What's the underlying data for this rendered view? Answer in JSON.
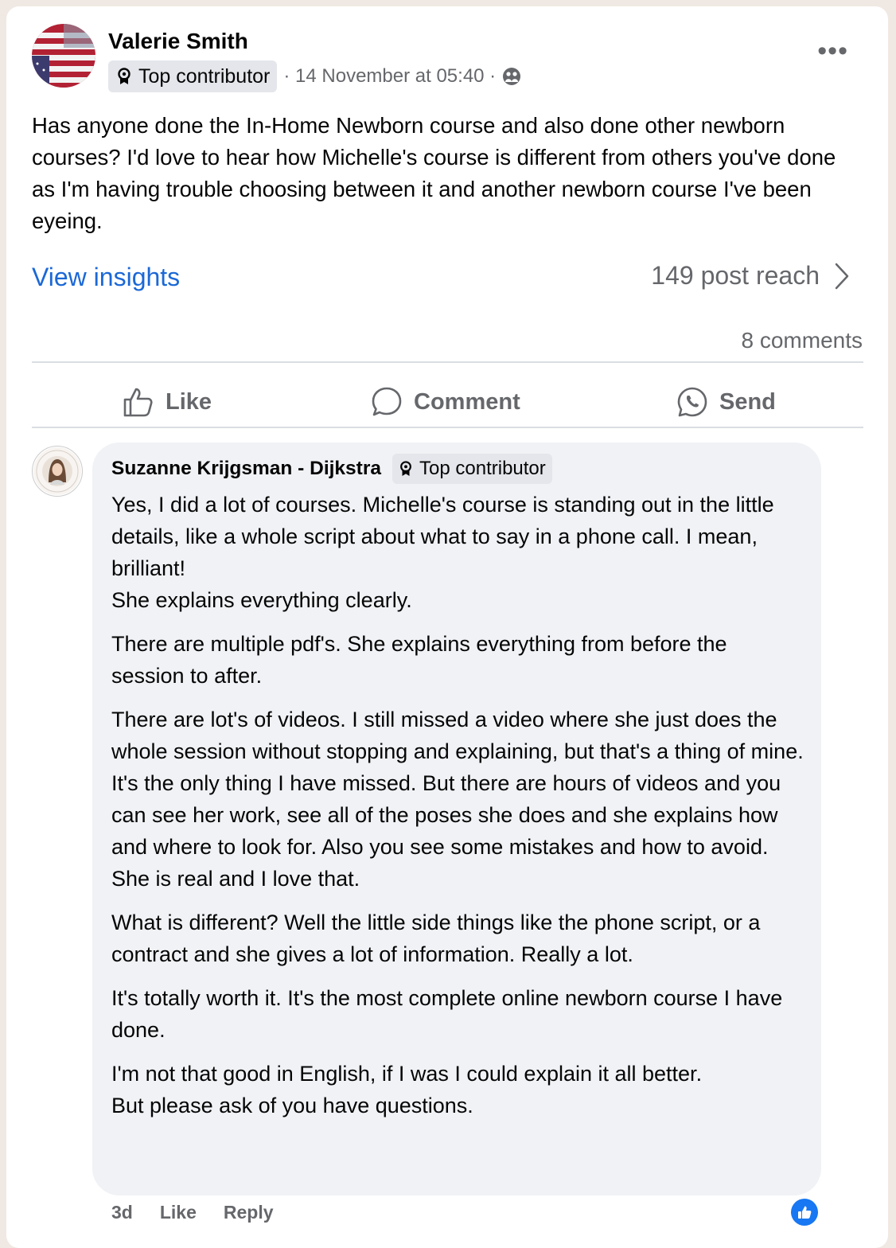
{
  "post": {
    "author": "Valerie Smith",
    "badge": "Top contributor",
    "timestamp": "· 14 November at 05:40 ·",
    "privacy_icon": "group-icon",
    "more_label": "•••",
    "text": "Has anyone done the In-Home Newborn course and also done other newborn courses? I'd love to hear how Michelle's course is different from others you've done as I'm having trouble choosing between it and another newborn course I've been eyeing.",
    "view_insights": "View insights",
    "reach": "149 post reach",
    "comments_count": "8 comments"
  },
  "actions": {
    "like": "Like",
    "comment": "Comment",
    "send": "Send"
  },
  "comment": {
    "author": "Suzanne Krijgsman - Dijkstra",
    "badge": "Top contributor",
    "paragraphs": [
      [
        "Yes, I did a lot of courses. Michelle's course is standing out in the little details, like a whole script about what to say in a phone call. I mean, brilliant!",
        "She explains everything clearly."
      ],
      [
        "There are multiple pdf's. She explains everything from before the session to after."
      ],
      [
        "There are lot's of videos. I still missed a video where she just does the whole session without stopping and explaining, but that's a thing of mine. It's the only thing I have missed. But there are hours of videos and you can see her work, see all of the poses she does and she explains how and where to look for. Also you see some mistakes and how to avoid. She is real and I love that."
      ],
      [
        "What is different? Well the little side things like the phone script, or a contract and she gives a lot of information. Really a lot."
      ],
      [
        "It's totally worth it. It's the most complete online newborn course I have done."
      ],
      [
        "I'm not that good in English, if I was I could explain it all better.",
        "But please ask of you have questions."
      ]
    ],
    "age": "3d",
    "like": "Like",
    "reply": "Reply"
  },
  "colors": {
    "link": "#1b68d6",
    "secondary_text": "#65676b",
    "bubble": "#f0f2f5",
    "reaction_blue": "#1877f2"
  }
}
